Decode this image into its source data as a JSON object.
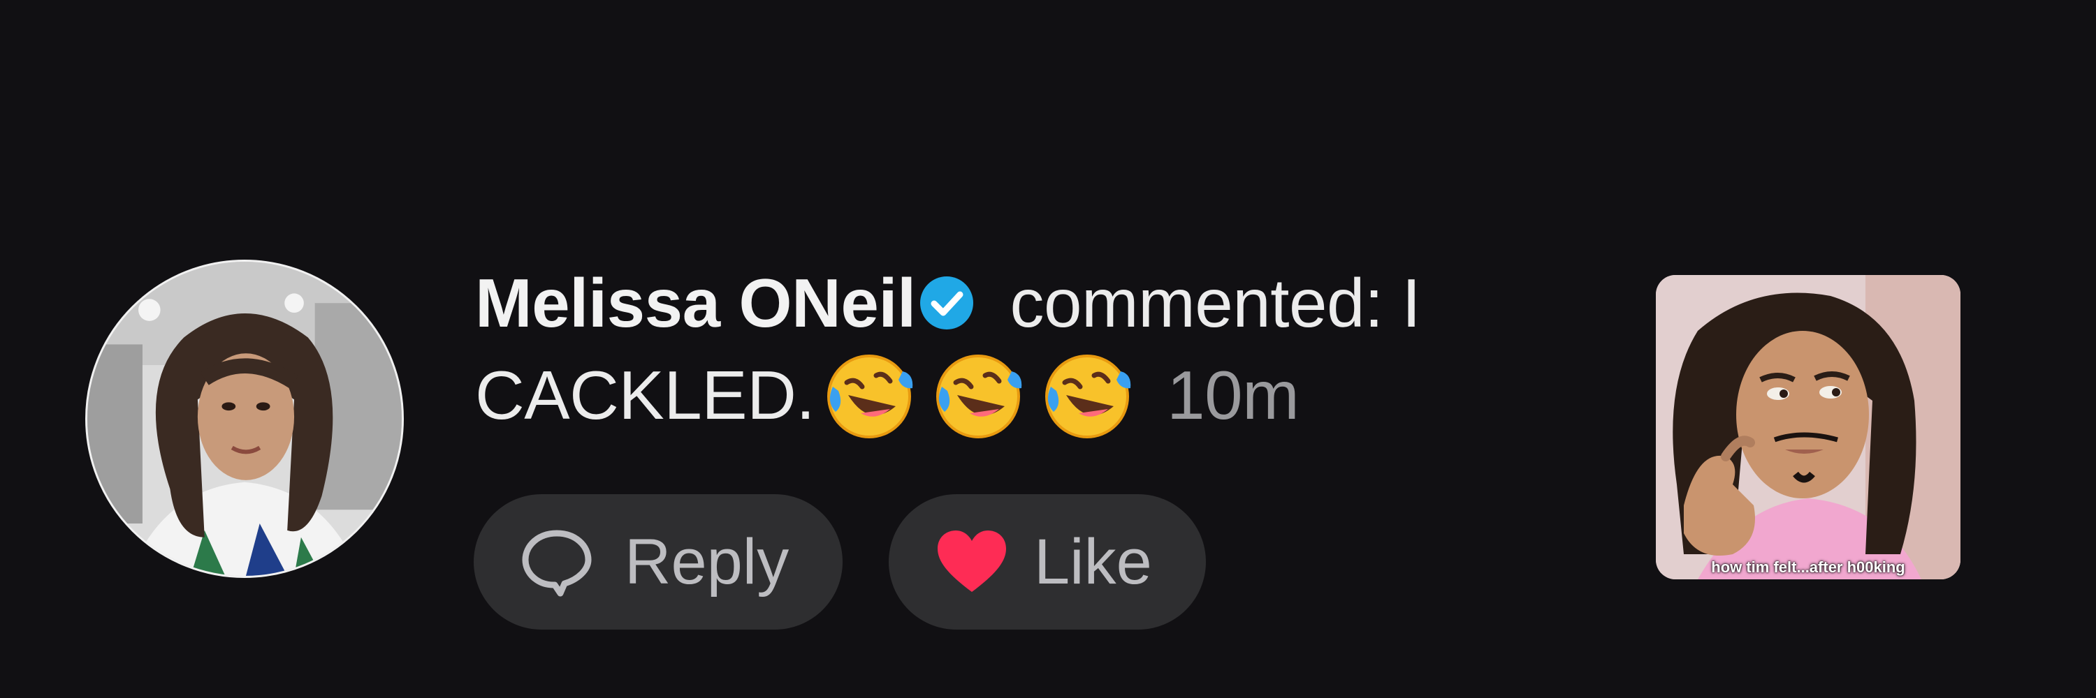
{
  "notification": {
    "user_name": "Melissa ONeil",
    "verified": true,
    "action_text": " commented: I CACKLED.",
    "emoji": [
      "rolling-on-floor-laughing",
      "rolling-on-floor-laughing",
      "rolling-on-floor-laughing"
    ],
    "time_ago": "10m"
  },
  "actions": {
    "reply_label": "Reply",
    "like_label": "Like"
  },
  "thumbnail": {
    "caption": "how tim felt...after h00king"
  },
  "colors": {
    "background": "#111013",
    "button_bg": "#2e2e30",
    "verified_blue": "#20a8e6",
    "like_red": "#fe2c55"
  }
}
